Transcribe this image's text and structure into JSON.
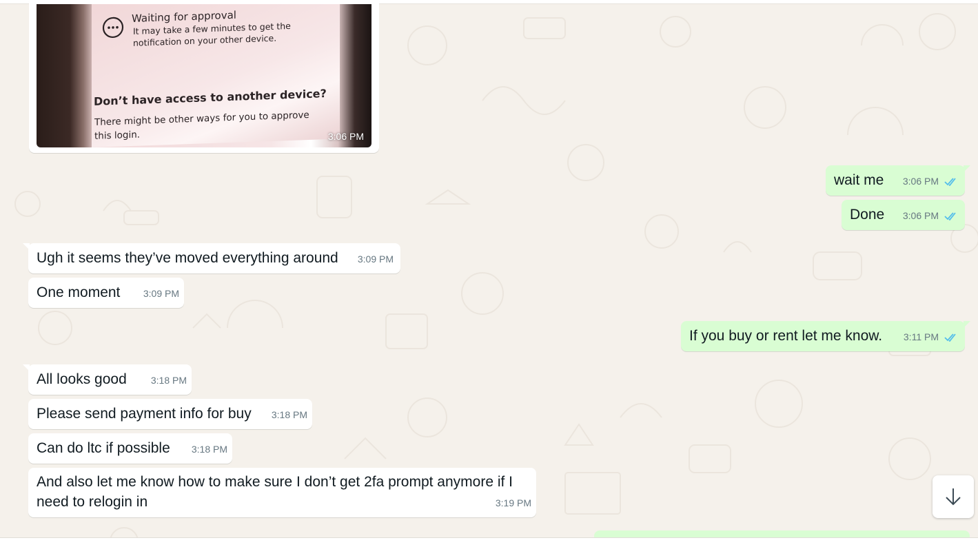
{
  "photo_message": {
    "screen_lines": {
      "waiting_title": "Waiting for approval",
      "waiting_line1": "It may take a few minutes to get the",
      "waiting_line2": "notification on your other device.",
      "no_access_title": "Don’t have access to another device?",
      "other_ways_line1": "There might be other ways for you to approve",
      "other_ways_line2": "this login."
    },
    "time": "3:06 PM"
  },
  "messages": [
    {
      "direction": "out",
      "text": "wait me",
      "time": "3:06 PM",
      "status": "read"
    },
    {
      "direction": "out",
      "text": "Done",
      "time": "3:06 PM",
      "status": "read"
    },
    {
      "direction": "in",
      "text": "Ugh it seems they’ve moved everything around",
      "time": "3:09 PM"
    },
    {
      "direction": "in",
      "text": "One moment",
      "time": "3:09 PM"
    },
    {
      "direction": "out",
      "text": "If you buy or rent let me know.",
      "time": "3:11 PM",
      "status": "read"
    },
    {
      "direction": "in",
      "text": "All looks good",
      "time": "3:18 PM"
    },
    {
      "direction": "in",
      "text": "Please send payment info for buy",
      "time": "3:18 PM"
    },
    {
      "direction": "in",
      "text": "Can do ltc if possible",
      "time": "3:18 PM"
    },
    {
      "direction": "in",
      "text_line1": "And also let me know how to make sure I don’t get 2fa prompt anymore if I",
      "text_line2": "need to relogin in",
      "time": "3:19 PM"
    }
  ],
  "icons": {
    "read_receipt": "double-check-icon",
    "scroll_down": "arrow-down-icon",
    "waiting": "ellipsis-circle-icon"
  },
  "colors": {
    "outgoing_bubble": "#d9fdd3",
    "incoming_bubble": "#ffffff",
    "chat_background": "#f5f1eb",
    "read_tick": "#53bdeb",
    "meta_text": "#667781"
  }
}
